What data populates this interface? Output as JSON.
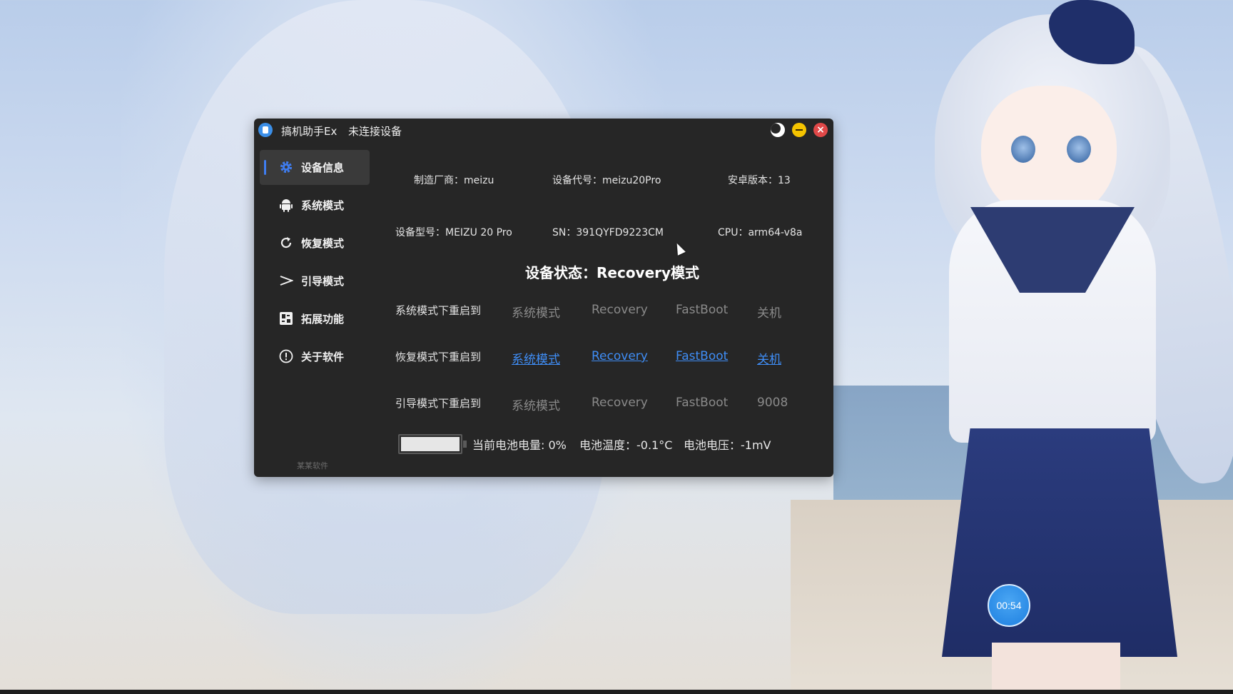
{
  "window": {
    "app_name": "搞机助手Ex",
    "connection_status": "未连接设备"
  },
  "sidebar": {
    "items": [
      {
        "label": "设备信息",
        "icon": "gear-icon",
        "active": true
      },
      {
        "label": "系统模式",
        "icon": "android-icon",
        "active": false
      },
      {
        "label": "恢复模式",
        "icon": "refresh-icon",
        "active": false
      },
      {
        "label": "引导模式",
        "icon": "chevron-right-icon",
        "active": false
      },
      {
        "label": "拓展功能",
        "icon": "extension-icon",
        "active": false
      },
      {
        "label": "关于软件",
        "icon": "info-icon",
        "active": false
      }
    ],
    "footer": "某某软件"
  },
  "device_info": {
    "manufacturer": "制造厂商：meizu",
    "codename": "设备代号：meizu20Pro",
    "android_version": "安卓版本：13",
    "model": "设备型号：MEIZU 20 Pro",
    "sn": "SN：391QYFD9223CM",
    "cpu": "CPU：arm64-v8a"
  },
  "device_status": "设备状态：Recovery模式",
  "reboot_rows": [
    {
      "label": "系统模式下重启到",
      "actions": [
        "系统模式",
        "Recovery",
        "FastBoot",
        "关机"
      ],
      "enabled": false
    },
    {
      "label": "恢复模式下重启到",
      "actions": [
        "系统模式",
        "Recovery",
        "FastBoot",
        "关机"
      ],
      "enabled": true
    },
    {
      "label": "引导模式下重启到",
      "actions": [
        "系统模式",
        "Recovery",
        "FastBoot",
        "9008"
      ],
      "enabled": false
    }
  ],
  "battery": {
    "level_text": "当前电池电量: 0%",
    "temperature_text": "电池温度：-0.1°C",
    "voltage_text": "电池电压：-1mV"
  },
  "timer": "00:54",
  "colors": {
    "window_bg": "#262626",
    "accent": "#3f7df0",
    "link": "#3f8df5",
    "disabled": "#8a8a8a",
    "close": "#e04848",
    "minimize": "#f5c400"
  }
}
